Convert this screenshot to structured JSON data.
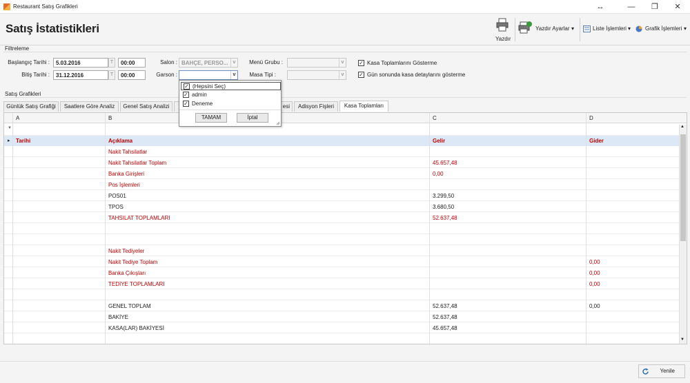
{
  "window": {
    "title": "Restaurant Satış Grafikleri",
    "controls": {
      "expand": "↔",
      "minimize": "—",
      "maximize": "❐",
      "close": "✕"
    }
  },
  "header": {
    "title": "Satış İstatistikleri",
    "toolbar": {
      "print": "Yazdır",
      "print_settings": "Yazdır Ayarlar",
      "list_ops": "Liste İşlemleri",
      "chart_ops": "Grafik İşlemleri",
      "dropdown_arrow": "▾"
    }
  },
  "filter": {
    "section_label": "Filtreleme",
    "start_date_label": "Başlangıç Tarihi :",
    "start_date": "5.03.2016",
    "start_time": "00:00",
    "end_date_label": "Bitiş Tarihi :",
    "end_date": "31.12.2016",
    "end_time": "00:00",
    "t_button": "T",
    "salon_label": "Salon :",
    "salon_value": "BAHÇE, PERSO...",
    "garson_label": "Garson :",
    "garson_value": "",
    "menu_group_label": "Menü Grubu :",
    "table_type_label": "Masa Tipi :",
    "check_kasa_totals": "Kasa Toplamlarını Gösterme",
    "check_day_end": "Gün sonunda kasa detaylarını gösterme",
    "arrow": "v"
  },
  "garson_dropdown": {
    "items": [
      {
        "label": "(Hepsini Seç)",
        "checked": true
      },
      {
        "label": "admin",
        "checked": true
      },
      {
        "label": "Deneme",
        "checked": true
      }
    ],
    "ok_label": "TAMAM",
    "cancel_label": "İptal"
  },
  "charts": {
    "section_label": "Satış Grafikleri",
    "tabs": [
      "Günlük Satış Grafiği",
      "Saatlere Göre Analiz",
      "Genel Satış Analizi",
      "esi",
      "Adisyon Fişleri",
      "Kasa Toplamları"
    ],
    "active_tab": "Kasa Toplamları"
  },
  "grid": {
    "columns": [
      "A",
      "B",
      "C",
      "D"
    ],
    "filter_icon": "▼",
    "row_marker": "▸",
    "header_row": [
      "Tarihi",
      "Açıklama",
      "Gelir",
      "Gider"
    ],
    "rows": [
      {
        "b": "Nakit Tahsilatlar",
        "c": "",
        "d": "",
        "red": true
      },
      {
        "b": "Nakit Tahsilatlar Toplam",
        "c": "45.657,48",
        "d": "",
        "red": true
      },
      {
        "b": "Banka Girişleri",
        "c": "0,00",
        "d": "",
        "red": true
      },
      {
        "b": "Pos İşlemleri",
        "c": "",
        "d": "",
        "red": true
      },
      {
        "b": "POS01",
        "c": "3.299,50",
        "d": "",
        "red": false
      },
      {
        "b": "TPOS",
        "c": "3.680,50",
        "d": "",
        "red": false
      },
      {
        "b": "TAHSILAT TOPLAMLARI",
        "c": "52.637,48",
        "d": "",
        "red": true
      },
      {
        "b": "",
        "c": "",
        "d": "",
        "red": false
      },
      {
        "b": "",
        "c": "",
        "d": "",
        "red": false
      },
      {
        "b": "Nakit Tediyeler",
        "c": "",
        "d": "",
        "red": true
      },
      {
        "b": "Nakit Tediye Toplam",
        "c": "",
        "d": "0,00",
        "red": true
      },
      {
        "b": "Banka Çıkışları",
        "c": "",
        "d": "0,00",
        "red": true
      },
      {
        "b": "TEDİYE TOPLAMLARI",
        "c": "",
        "d": "0,00",
        "red": true
      },
      {
        "b": "",
        "c": "",
        "d": "",
        "red": false
      },
      {
        "b": "GENEL TOPLAM",
        "c": "52.637,48",
        "d": "0,00",
        "red": false
      },
      {
        "b": "BAKİYE",
        "c": "52.637,48",
        "d": "",
        "red": false
      },
      {
        "b": "KASA(LAR) BAKİYESİ",
        "c": "45.657,48",
        "d": "",
        "red": false
      }
    ],
    "scroll_up": "▲",
    "scroll_down": "▼"
  },
  "footer": {
    "refresh_label": "Yenile"
  },
  "colors": {
    "accent_red": "#c00000",
    "header_row_bg": "#dce8f5"
  }
}
